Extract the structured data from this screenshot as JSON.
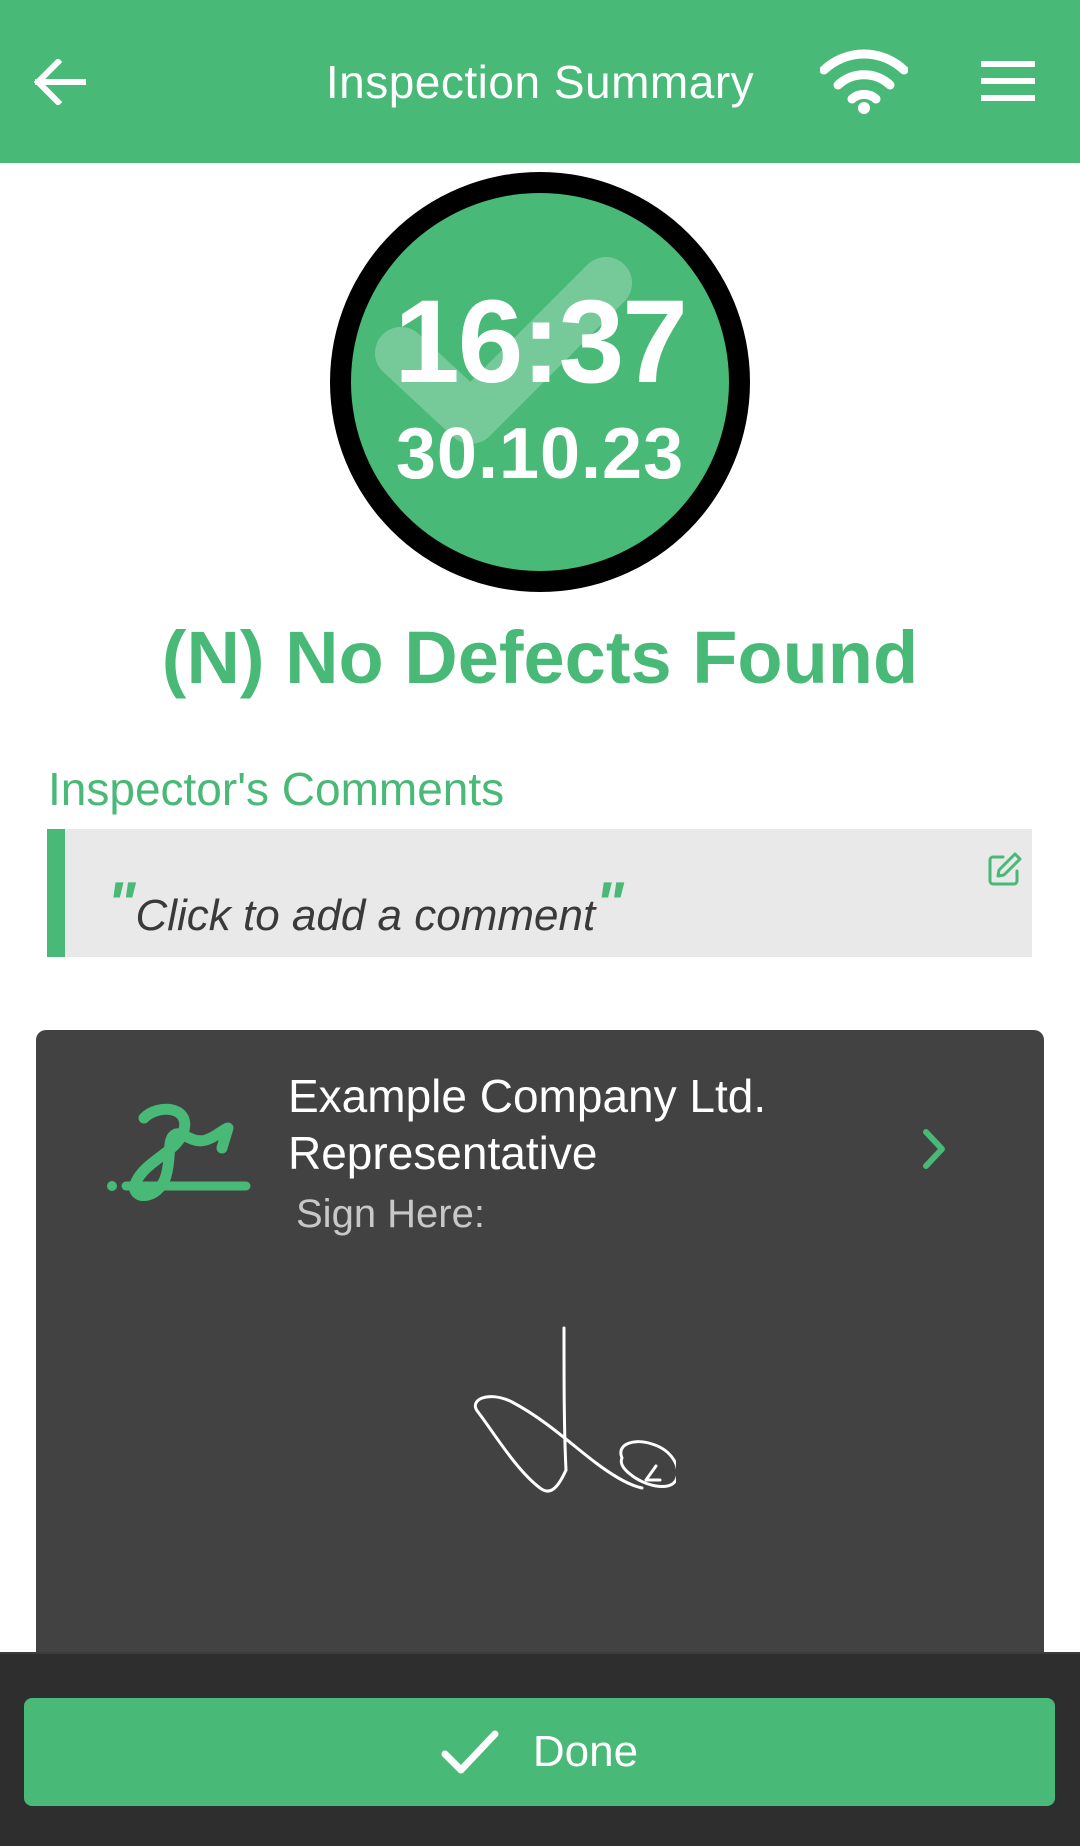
{
  "header": {
    "title": "Inspection Summary",
    "back_icon": "arrow-left-icon",
    "wifi_icon": "wifi-icon",
    "menu_icon": "hamburger-menu-icon"
  },
  "badge": {
    "time": "16:37",
    "date": "30.10.23",
    "background_icon": "checkmark-icon"
  },
  "status": {
    "text": "(N) No Defects Found",
    "color": "#49b977"
  },
  "comments": {
    "label": "Inspector's Comments",
    "placeholder": "Click to add a comment",
    "open_quote": "\"",
    "close_quote": "\"",
    "edit_icon": "edit-icon"
  },
  "signature_card": {
    "signer": "Example Company Ltd. Representative",
    "prompt": "Sign Here:",
    "icon": "signature-icon",
    "chevron_icon": "chevron-right-icon"
  },
  "footer": {
    "done_label": "Done",
    "done_icon": "checkmark-icon"
  },
  "colors": {
    "accent": "#49b977",
    "card": "#424242",
    "bottom_bar": "#2e2e2e",
    "comment_bg": "#e9e9e9"
  }
}
